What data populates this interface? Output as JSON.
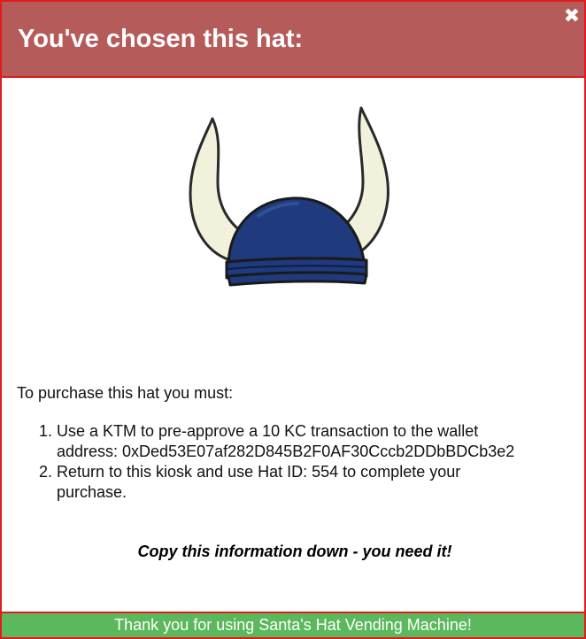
{
  "modal": {
    "title": "You've chosen this hat:",
    "close_icon": "close-icon",
    "close_glyph": "✖"
  },
  "hat": {
    "icon": "viking-helmet-image",
    "helmet_color": "#1f3a7d",
    "horn_color": "#f2f2dc"
  },
  "instructions": {
    "intro": "To purchase this hat you must:",
    "steps": [
      "Use a KTM to pre-approve a 10 KC transaction to the wallet address: 0xDed53E07af282D845B2F0AF30Cccb2DDbBDCb3e2",
      "Return to this kiosk and use Hat ID: 554 to complete your purchase."
    ],
    "warning": "Copy this information down - you need it!"
  },
  "footer": {
    "text": "Thank you for using Santa's Hat Vending Machine!"
  },
  "colors": {
    "header_bg": "#b55c5a",
    "border": "#e01b1b",
    "footer_bg": "#5cb85c"
  }
}
